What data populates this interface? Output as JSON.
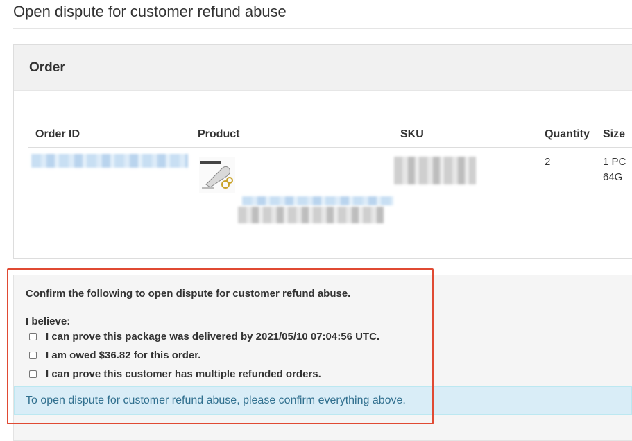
{
  "page": {
    "title": "Open dispute for customer refund abuse"
  },
  "order_panel": {
    "heading": "Order",
    "columns": [
      "Order ID",
      "Product",
      "SKU",
      "Quantity",
      "Size"
    ],
    "rows": [
      {
        "quantity": "2",
        "size_line1": "1 PC",
        "size_line2": "64G"
      }
    ]
  },
  "confirm_panel": {
    "intro": "Confirm the following to open dispute for customer refund abuse.",
    "believe_label": "I believe:",
    "checkboxes": [
      {
        "label": "I can prove this package was delivered by 2021/05/10 07:04:56 UTC."
      },
      {
        "label": "I am owed $36.82 for this order."
      },
      {
        "label": "I can prove this customer has multiple refunded orders."
      }
    ],
    "info_message": "To open dispute for customer refund abuse, please confirm everything above."
  },
  "annotation": {
    "highlight_color": "#e04a33"
  }
}
